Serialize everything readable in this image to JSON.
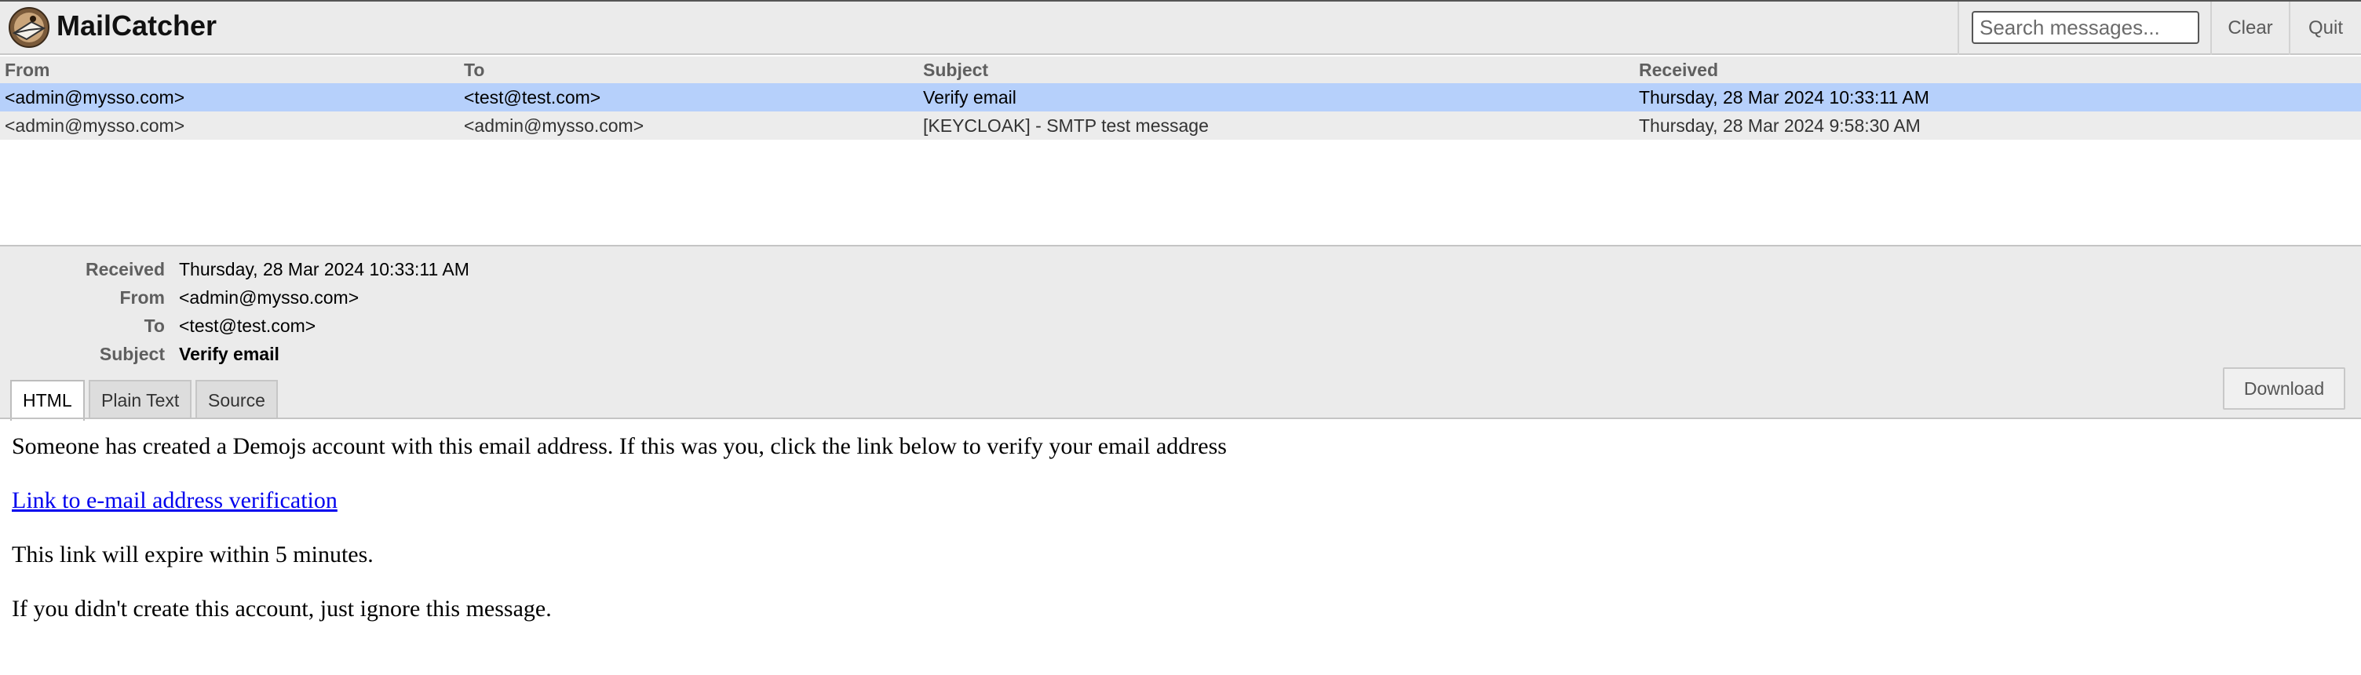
{
  "app": {
    "title": "MailCatcher",
    "logo_icon": "mailcatcher-logo-icon"
  },
  "header": {
    "search_placeholder": "Search messages...",
    "clear_label": "Clear",
    "quit_label": "Quit"
  },
  "message_list": {
    "columns": [
      "From",
      "To",
      "Subject",
      "Received"
    ],
    "rows": [
      {
        "from": "<admin@mysso.com>",
        "to": "<test@test.com>",
        "subject": "Verify email",
        "received": "Thursday, 28 Mar 2024 10:33:11 AM",
        "selected": true
      },
      {
        "from": "<admin@mysso.com>",
        "to": "<admin@mysso.com>",
        "subject": "[KEYCLOAK] - SMTP test message",
        "received": "Thursday, 28 Mar 2024 9:58:30 AM",
        "selected": false
      }
    ]
  },
  "message": {
    "labels": {
      "received": "Received",
      "from": "From",
      "to": "To",
      "subject": "Subject"
    },
    "received": "Thursday, 28 Mar 2024 10:33:11 AM",
    "from": "<admin@mysso.com>",
    "to": "<test@test.com>",
    "subject": "Verify email",
    "tabs": [
      {
        "label": "HTML",
        "active": true
      },
      {
        "label": "Plain Text",
        "active": false
      },
      {
        "label": "Source",
        "active": false
      }
    ],
    "download_label": "Download",
    "body": {
      "intro": "Someone has created a Demojs account with this email address. If this was you, click the link below to verify your email address",
      "link_text": "Link to e-mail address verification",
      "expiry": "This link will expire within 5 minutes.",
      "ignore": "If you didn't create this account, just ignore this message."
    }
  },
  "colors": {
    "header_bg": "#ebebeb",
    "selected_row": "#b6d0fb",
    "row_bg": "#ececec",
    "link": "#0000ee"
  }
}
